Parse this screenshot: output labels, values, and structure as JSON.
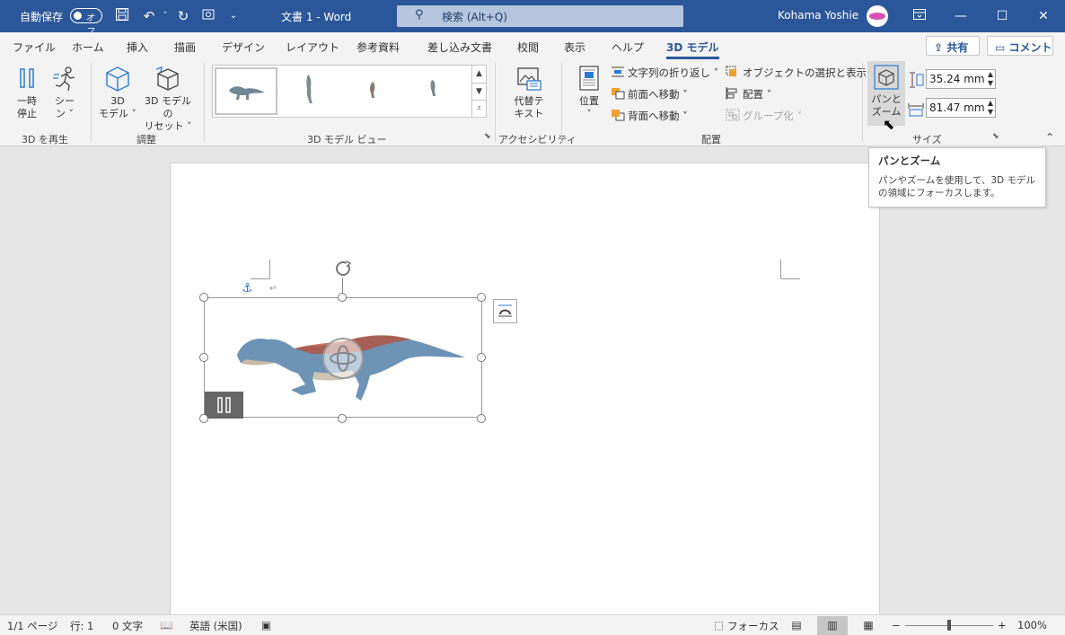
{
  "titlebar": {
    "autosave_label": "自動保存",
    "autosave_state": "オフ",
    "doc_title": "文書 1  -  Word",
    "search_placeholder": "検索 (Alt+Q)",
    "user_name": "Kohama Yoshie"
  },
  "tabs": [
    {
      "label": "ファイル"
    },
    {
      "label": "ホーム"
    },
    {
      "label": "挿入"
    },
    {
      "label": "描画"
    },
    {
      "label": "デザイン"
    },
    {
      "label": "レイアウト"
    },
    {
      "label": "参考資料"
    },
    {
      "label": "差し込み文書"
    },
    {
      "label": "校閲"
    },
    {
      "label": "表示"
    },
    {
      "label": "ヘルプ"
    },
    {
      "label": "3D モデル"
    }
  ],
  "share_label": "共有",
  "comment_label": "コメント",
  "ribbon": {
    "play_group": {
      "label": "3D を再生",
      "pause_line1": "一時",
      "pause_line2": "停止",
      "scene_line1": "シー",
      "scene_line2": "ン ˅"
    },
    "adjust_group": {
      "label": "調整",
      "model_line1": "3D",
      "model_line2": "モデル ˅",
      "reset_line1": "3D モデルの",
      "reset_line2": "リセット ˅"
    },
    "view_group": {
      "label": "3D モデル ビュー"
    },
    "accessibility_group": {
      "label": "アクセシビリティ",
      "alt_line1": "代替テ",
      "alt_line2": "キスト"
    },
    "arrange_group": {
      "label": "配置",
      "position_line1": "位置",
      "position_line2": "˅",
      "wrap_text": "文字列の折り返し ˅",
      "bring_forward": "前面へ移動 ˅",
      "send_backward": "背面へ移動 ˅",
      "selection_pane": "オブジェクトの選択と表示",
      "align": "配置 ˅",
      "group": "グループ化 ˅"
    },
    "size_group": {
      "label": "サイズ",
      "pan_line1": "パンと",
      "pan_line2": "ズーム",
      "height": "35.24 mm",
      "width": "81.47 mm"
    }
  },
  "tooltip": {
    "title": "パンとズーム",
    "body_line1": "パンやズームを使用して、3D モデル",
    "body_line2": "の領域にフォーカスします。"
  },
  "status": {
    "page": "1/1 ページ",
    "line": "行: 1",
    "words": "0 文字",
    "language": "英語 (米国)",
    "focus": "フォーカス",
    "zoom_pct": "100%",
    "zoom_level": 0.5
  },
  "colors": {
    "title_bar": "#2b579a",
    "accent": "#2b579a",
    "ribbon_bg": "#f3f3f3"
  }
}
